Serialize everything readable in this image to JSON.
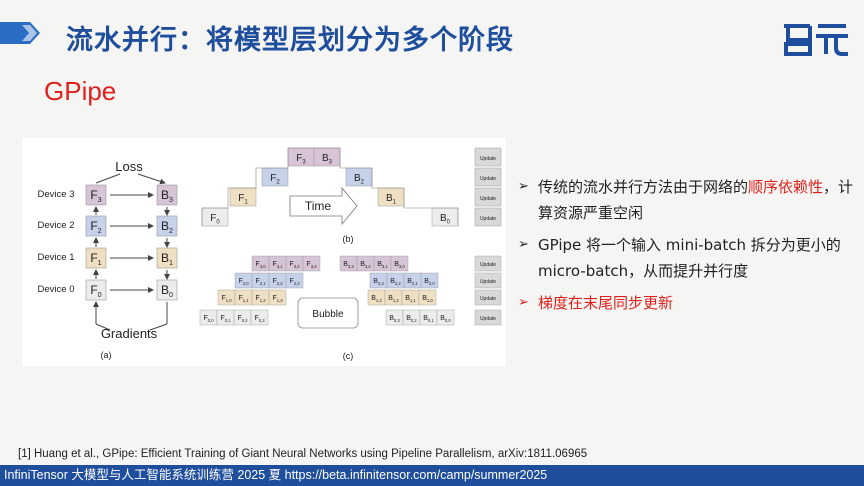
{
  "slide": {
    "title": "流水并行：将模型层划分为多个阶段",
    "subtitle": "GPipe",
    "logo_text": "启元"
  },
  "figure": {
    "a": {
      "loss_label": "Loss",
      "gradients_label": "Gradients",
      "caption": "(a)",
      "devices": [
        "Device 3",
        "Device 2",
        "Device 1",
        "Device 0"
      ],
      "forward": [
        "F",
        "F",
        "F",
        "F"
      ],
      "forward_sub": [
        "3",
        "2",
        "1",
        "0"
      ],
      "backward": [
        "B",
        "B",
        "B",
        "B"
      ],
      "backward_sub": [
        "3",
        "2",
        "1",
        "0"
      ]
    },
    "b": {
      "caption": "(b)",
      "time_label": "Time",
      "cells": [
        {
          "t": "F",
          "s": "3"
        },
        {
          "t": "B",
          "s": "3"
        },
        {
          "t": "F",
          "s": "2"
        },
        {
          "t": "B",
          "s": "2"
        },
        {
          "t": "F",
          "s": "1"
        },
        {
          "t": "B",
          "s": "1"
        },
        {
          "t": "F",
          "s": "0"
        },
        {
          "t": "B",
          "s": "0"
        }
      ],
      "update": "Update"
    },
    "c": {
      "caption": "(c)",
      "bubble_label": "Bubble",
      "update": "Update",
      "rows": [
        {
          "f": [
            "F3,0",
            "F3,1",
            "F3,2",
            "F3,3"
          ],
          "b": [
            "B3,3",
            "B3,2",
            "B3,1",
            "B3,0"
          ]
        },
        {
          "f": [
            "F2,0",
            "F2,1",
            "F2,2",
            "F2,3"
          ],
          "b": [
            "B2,3",
            "B2,2",
            "B2,1",
            "B2,0"
          ]
        },
        {
          "f": [
            "F1,0",
            "F1,1",
            "F1,2",
            "F1,3"
          ],
          "b": [
            "B1,3",
            "B1,2",
            "B1,1",
            "B1,0"
          ]
        },
        {
          "f": [
            "F0,0",
            "F0,1",
            "F0,2",
            "F0,3"
          ],
          "b": [
            "B0,3",
            "B0,2",
            "B0,1",
            "B0,0"
          ]
        }
      ]
    }
  },
  "bullets": [
    {
      "arrow": "➢",
      "parts": [
        {
          "text": "传统的流水并行方法由于网络的",
          "red": false
        },
        {
          "text": "顺序依赖性",
          "red": true
        },
        {
          "text": "，计算资源严重空闲",
          "red": false
        }
      ]
    },
    {
      "arrow": "➢",
      "parts": [
        {
          "text": "GPipe 将一个输入 mini-batch 拆分为更小的 micro-batch，从而提升并行度",
          "red": false
        }
      ]
    },
    {
      "arrow": "➢",
      "parts": [
        {
          "text": "梯度在末尾同步更新",
          "red": true
        }
      ]
    }
  ],
  "reference": "[1] Huang et al., GPipe: Efficient Training of Giant Neural Networks using Pipeline Parallelism, arXiv:1811.06965",
  "footer": "InfiniTensor 大模型与人工智能系统训练营 2025 夏    https://beta.infinitensor.com/camp/summer2025",
  "colors": {
    "row3": "#d7c4d6",
    "row2": "#c5d2ea",
    "row1": "#efe0c3",
    "row0": "#ececec",
    "update": "#d9d9d9",
    "title": "#1f4e9c",
    "accent": "#e0211b"
  }
}
